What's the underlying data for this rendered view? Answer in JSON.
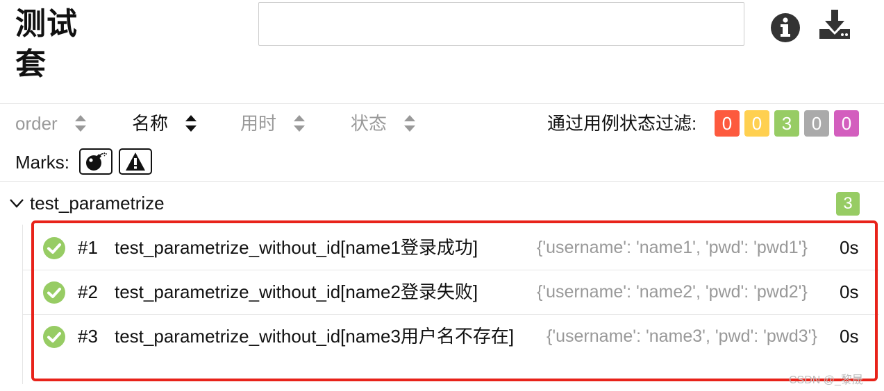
{
  "header": {
    "title": "测试套",
    "search_value": ""
  },
  "toolbar": {
    "sorts": [
      {
        "label": "order",
        "active": false
      },
      {
        "label": "名称",
        "active": true
      },
      {
        "label": "用时",
        "active": false
      },
      {
        "label": "状态",
        "active": false
      }
    ],
    "filter_label": "通过用例状态过滤:",
    "filter_badges": [
      {
        "status": "failed",
        "count": "0",
        "color": "#fd5a3e"
      },
      {
        "status": "broken",
        "count": "0",
        "color": "#ffd050"
      },
      {
        "status": "passed",
        "count": "3",
        "color": "#97cc64"
      },
      {
        "status": "skipped",
        "count": "0",
        "color": "#aaaaaa"
      },
      {
        "status": "unknown",
        "count": "0",
        "color": "#d35ebe"
      }
    ],
    "marks_label": "Marks:",
    "marks": [
      {
        "name": "flaky",
        "icon": "bomb-icon"
      },
      {
        "name": "new-failed",
        "icon": "warning-icon"
      }
    ]
  },
  "suite": {
    "name": "test_parametrize",
    "count": "3",
    "count_color": "#97cc64"
  },
  "cases": [
    {
      "order": "#1",
      "name": "test_parametrize_without_id[name1登录成功]",
      "params": "{'username': 'name1', 'pwd': 'pwd1'}",
      "duration": "0s",
      "status": "passed"
    },
    {
      "order": "#2",
      "name": "test_parametrize_without_id[name2登录失败]",
      "params": "{'username': 'name2', 'pwd': 'pwd2'}",
      "duration": "0s",
      "status": "passed"
    },
    {
      "order": "#3",
      "name": "test_parametrize_without_id[name3用户名不存在]",
      "params": "{'username': 'name3', 'pwd': 'pwd3'}",
      "duration": "0s",
      "status": "passed"
    }
  ],
  "colors": {
    "passed": "#97cc64",
    "highlight": "#e8231a"
  },
  "watermark": "CSDN @_黎晟"
}
